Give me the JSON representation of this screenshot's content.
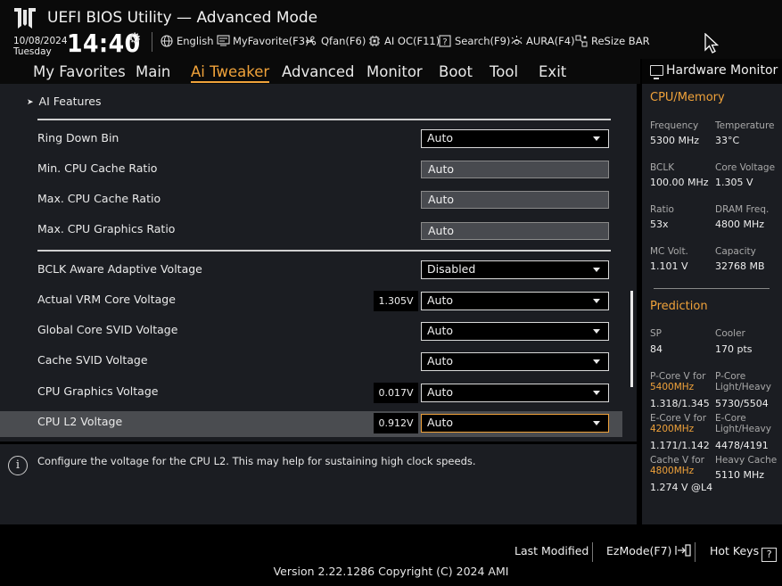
{
  "header": {
    "title": "UEFI BIOS Utility — Advanced Mode",
    "date": "10/08/2024",
    "day": "Tuesday",
    "time": "14:40",
    "tools": [
      {
        "label": "English",
        "icon": "globe-icon"
      },
      {
        "label": "MyFavorite(F3)",
        "icon": "my-favorite-icon"
      },
      {
        "label": "Qfan(F6)",
        "icon": "fan-icon"
      },
      {
        "label": "AI OC(F11)",
        "icon": "ai-oc-icon"
      },
      {
        "label": "Search(F9)",
        "icon": "search-icon"
      },
      {
        "label": "AURA(F4)",
        "icon": "aura-icon"
      },
      {
        "label": "ReSize BAR",
        "icon": "resize-bar-icon"
      }
    ]
  },
  "nav": {
    "tabs": [
      "My Favorites",
      "Main",
      "Ai Tweaker",
      "Advanced",
      "Monitor",
      "Boot",
      "Tool",
      "Exit"
    ],
    "active": "Ai Tweaker"
  },
  "main": {
    "ai_features": "AI Features",
    "rows": [
      {
        "label": "Ring Down Bin",
        "value": "Auto",
        "kind": "dropdown"
      },
      {
        "label": "Min. CPU Cache Ratio",
        "value": "Auto",
        "kind": "text"
      },
      {
        "label": "Max. CPU Cache Ratio",
        "value": "Auto",
        "kind": "text"
      },
      {
        "label": "Max. CPU Graphics Ratio",
        "value": "Auto",
        "kind": "text"
      },
      {
        "label": "BCLK Aware Adaptive Voltage",
        "value": "Disabled",
        "kind": "dropdown"
      },
      {
        "label": "Actual VRM Core Voltage",
        "value": "Auto",
        "kind": "dropdown",
        "reading": "1.305V"
      },
      {
        "label": "Global Core SVID Voltage",
        "value": "Auto",
        "kind": "dropdown"
      },
      {
        "label": "Cache SVID Voltage",
        "value": "Auto",
        "kind": "dropdown"
      },
      {
        "label": "CPU Graphics Voltage",
        "value": "Auto",
        "kind": "dropdown",
        "reading": "0.017V"
      },
      {
        "label": "CPU L2 Voltage",
        "value": "Auto",
        "kind": "dropdown",
        "reading": "0.912V"
      }
    ],
    "help_text": "Configure the voltage for the CPU L2. This may help for sustaining high clock speeds."
  },
  "hw_monitor": {
    "title": "Hardware Monitor",
    "cpu_memory": {
      "section": "CPU/Memory",
      "frequency_label": "Frequency",
      "frequency": "5300 MHz",
      "temperature_label": "Temperature",
      "temperature": "33°C",
      "bclk_label": "BCLK",
      "bclk": "100.00 MHz",
      "core_voltage_label": "Core Voltage",
      "core_voltage": "1.305 V",
      "ratio_label": "Ratio",
      "ratio": "53x",
      "dram_freq_label": "DRAM Freq.",
      "dram_freq": "4800 MHz",
      "mc_volt_label": "MC Volt.",
      "mc_volt": "1.101 V",
      "capacity_label": "Capacity",
      "capacity": "32768 MB"
    },
    "prediction": {
      "section": "Prediction",
      "sp_label": "SP",
      "sp": "84",
      "cooler_label": "Cooler",
      "cooler": "170 pts",
      "pcore_v_label": "P-Core V for",
      "pcore_v_freq": "5400MHz",
      "pcore_v": "1.318/1.345",
      "pcore_lh_label": "P-Core Light/Heavy",
      "pcore_lh": "5730/5504",
      "ecore_v_label": "E-Core V for",
      "ecore_v_freq": "4200MHz",
      "ecore_v": "1.171/1.142",
      "ecore_lh_label": "E-Core Light/Heavy",
      "ecore_lh": "4478/4191",
      "cache_v_label": "Cache V for",
      "cache_v_freq": "4800MHz",
      "cache_v": "1.274 V @L4",
      "heavy_cache_label": "Heavy Cache",
      "heavy_cache": "5110 MHz"
    }
  },
  "footer": {
    "last_modified": "Last Modified",
    "ezmode": "EzMode(F7)",
    "hot_keys": "Hot Keys",
    "hot_keys_glyph": "?",
    "version": "Version 2.22.1286 Copyright (C) 2024 AMI"
  },
  "colors": {
    "accent": "#f0a23a",
    "panel": "#1b1d22",
    "selected_row": "#4a4c50"
  }
}
